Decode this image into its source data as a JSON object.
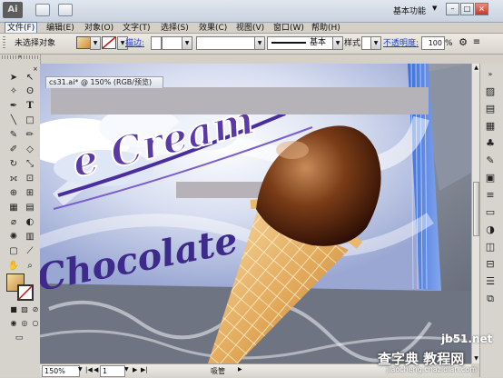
{
  "app": {
    "logo_text": "Ai"
  },
  "menu": {
    "items": [
      "文件(F)",
      "编辑(E)",
      "对象(O)",
      "文字(T)",
      "选择(S)",
      "效果(C)",
      "视图(V)",
      "窗口(W)",
      "帮助(H)"
    ],
    "workspace": "基本功能"
  },
  "control": {
    "selection_status": "未选择对象",
    "stroke_label": "描边:",
    "brush_label": "基本",
    "style_label": "样式:",
    "opacity_label": "不透明度:",
    "opacity_value": "100",
    "opacity_unit": "%"
  },
  "document": {
    "tab_title": "cs31.ai* @ 150% (RGB/预览)"
  },
  "artwork": {
    "headline": "e Cream",
    "subline": "Chocolate"
  },
  "status": {
    "zoom": "150%",
    "page": "1",
    "tool_label": "吸管"
  },
  "watermark": {
    "site": "jb51.net",
    "name": "查字典 教程网",
    "url": "jiaocheng.chazidian.com"
  },
  "colors": {
    "fill_gradient_light": "#f6dea5",
    "fill_gradient_dark": "#c98c3d",
    "link_blue": "#1b3ec7",
    "banner_purple": "#4a2f9c"
  }
}
